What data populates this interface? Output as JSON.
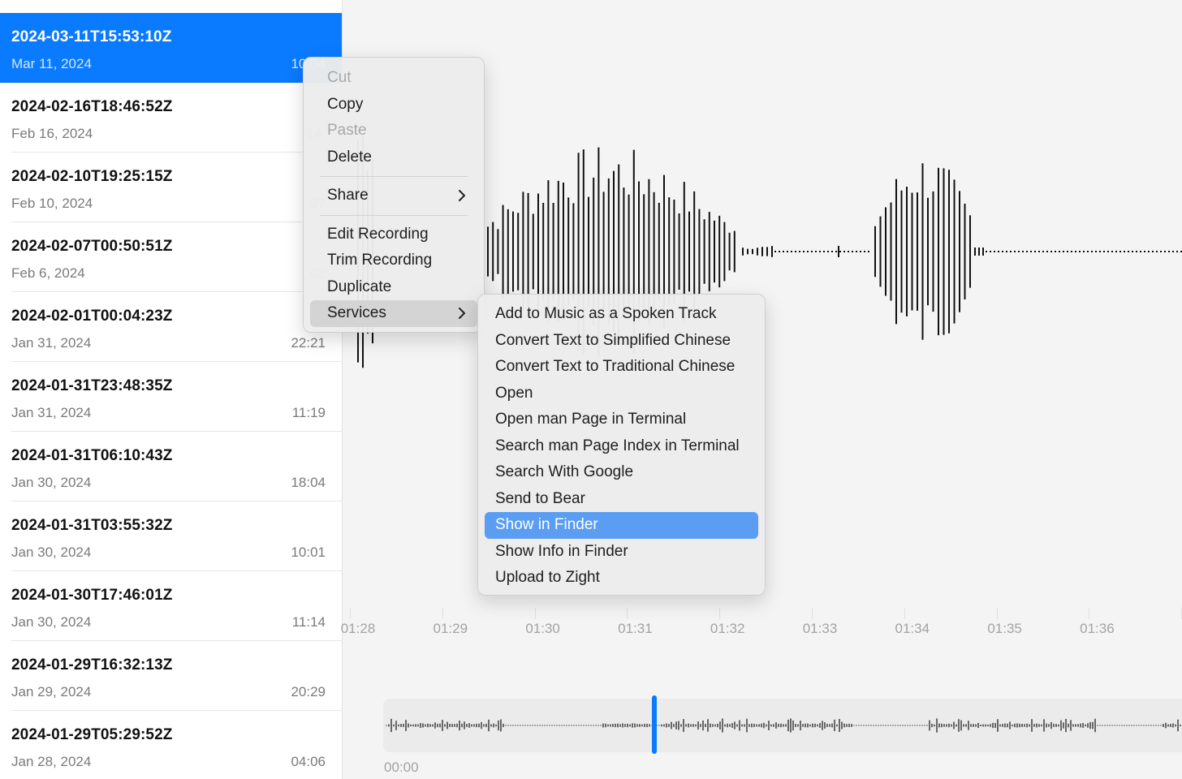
{
  "recordings": [
    {
      "title": "2024-03-11T15:53:10Z",
      "date": "Mar 11, 2024",
      "duration": "10:04",
      "selected": true
    },
    {
      "title": "2024-02-16T18:46:52Z",
      "date": "Feb 16, 2024",
      "duration": "14:",
      "selected": false
    },
    {
      "title": "2024-02-10T19:25:15Z",
      "date": "Feb 10, 2024",
      "duration": "07",
      "selected": false
    },
    {
      "title": "2024-02-07T00:50:51Z",
      "date": "Feb 6, 2024",
      "duration": "02",
      "selected": false
    },
    {
      "title": "2024-02-01T00:04:23Z",
      "date": "Jan 31, 2024",
      "duration": "22:21",
      "selected": false
    },
    {
      "title": "2024-01-31T23:48:35Z",
      "date": "Jan 31, 2024",
      "duration": "11:19",
      "selected": false
    },
    {
      "title": "2024-01-31T06:10:43Z",
      "date": "Jan 30, 2024",
      "duration": "18:04",
      "selected": false
    },
    {
      "title": "2024-01-31T03:55:32Z",
      "date": "Jan 30, 2024",
      "duration": "10:01",
      "selected": false
    },
    {
      "title": "2024-01-30T17:46:01Z",
      "date": "Jan 30, 2024",
      "duration": "11:14",
      "selected": false
    },
    {
      "title": "2024-01-29T16:32:13Z",
      "date": "Jan 29, 2024",
      "duration": "20:29",
      "selected": false
    },
    {
      "title": "2024-01-29T05:29:52Z",
      "date": "Jan 28, 2024",
      "duration": "04:06",
      "selected": false
    }
  ],
  "context_menu": {
    "cut": "Cut",
    "copy": "Copy",
    "paste": "Paste",
    "delete": "Delete",
    "share": "Share",
    "edit_recording": "Edit Recording",
    "trim_recording": "Trim Recording",
    "duplicate": "Duplicate",
    "services": "Services"
  },
  "services_menu": [
    "Add to Music as a Spoken Track",
    "Convert Text to Simplified Chinese",
    "Convert Text to Traditional Chinese",
    "Open",
    "Open man Page in Terminal",
    "Search man Page Index in Terminal",
    "Search With Google",
    "Send to Bear",
    "Show in Finder",
    "Show Info in Finder",
    "Upload to Zight"
  ],
  "services_active": "Show in Finder",
  "timeline": {
    "ticks": [
      "01:28",
      "01:29",
      "01:30",
      "01:31",
      "01:32",
      "01:33",
      "01:34",
      "01:35",
      "01:36",
      "01"
    ]
  },
  "overview": {
    "start_time": "00:00"
  },
  "colors": {
    "accent": "#0a7aff",
    "menu_highlight": "#5a9df3"
  }
}
